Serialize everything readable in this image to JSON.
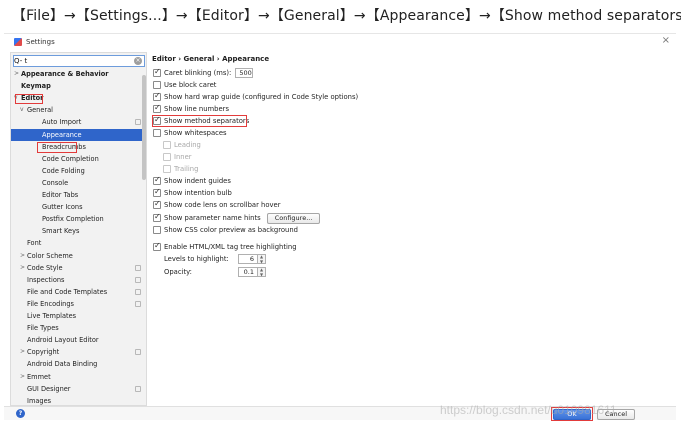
{
  "caption": "【File】→【Settings...】→【Editor】→【General】→【Appearance】→【Show method separators】",
  "window": {
    "title": "Settings",
    "close_glyph": "×"
  },
  "search": {
    "value": "Q- t",
    "icon": "search-icon"
  },
  "tree": [
    {
      "label": "Appearance & Behavior",
      "arrow": ">",
      "bold": true
    },
    {
      "label": "Keymap",
      "arrow": "",
      "bold": true
    },
    {
      "label": "Editor",
      "arrow": "v",
      "bold": true
    },
    {
      "label": "General",
      "arrow": "v",
      "bold": false
    },
    {
      "label": "Auto Import",
      "arrow": "",
      "bold": false,
      "cfg": true
    },
    {
      "label": "Appearance",
      "arrow": "",
      "bold": false,
      "selected": true
    },
    {
      "label": "Breadcrumbs",
      "arrow": "",
      "bold": false
    },
    {
      "label": "Code Completion",
      "arrow": "",
      "bold": false
    },
    {
      "label": "Code Folding",
      "arrow": "",
      "bold": false
    },
    {
      "label": "Console",
      "arrow": "",
      "bold": false
    },
    {
      "label": "Editor Tabs",
      "arrow": "",
      "bold": false
    },
    {
      "label": "Gutter Icons",
      "arrow": "",
      "bold": false
    },
    {
      "label": "Postfix Completion",
      "arrow": "",
      "bold": false
    },
    {
      "label": "Smart Keys",
      "arrow": "",
      "bold": false
    },
    {
      "label": "Font",
      "arrow": "",
      "bold": false
    },
    {
      "label": "Color Scheme",
      "arrow": ">",
      "bold": false
    },
    {
      "label": "Code Style",
      "arrow": ">",
      "bold": false,
      "cfg": true
    },
    {
      "label": "Inspections",
      "arrow": "",
      "bold": false,
      "cfg": true
    },
    {
      "label": "File and Code Templates",
      "arrow": "",
      "bold": false,
      "cfg": true
    },
    {
      "label": "File Encodings",
      "arrow": "",
      "bold": false,
      "cfg": true
    },
    {
      "label": "Live Templates",
      "arrow": "",
      "bold": false
    },
    {
      "label": "File Types",
      "arrow": "",
      "bold": false
    },
    {
      "label": "Android Layout Editor",
      "arrow": "",
      "bold": false
    },
    {
      "label": "Copyright",
      "arrow": ">",
      "bold": false,
      "cfg": true
    },
    {
      "label": "Android Data Binding",
      "arrow": "",
      "bold": false
    },
    {
      "label": "Emmet",
      "arrow": ">",
      "bold": false
    },
    {
      "label": "GUI Designer",
      "arrow": "",
      "bold": false,
      "cfg": true
    },
    {
      "label": "Images",
      "arrow": "",
      "bold": false
    }
  ],
  "breadcrumb": "Editor › General › Appearance",
  "options": {
    "caret_blinking": {
      "label": "Caret blinking (ms):",
      "checked": true,
      "value": "500"
    },
    "block_caret": {
      "label": "Use block caret",
      "checked": false
    },
    "hard_wrap": {
      "label": "Show hard wrap guide (configured in Code Style options)",
      "checked": true
    },
    "line_numbers": {
      "label": "Show line numbers",
      "checked": true
    },
    "method_separators": {
      "label": "Show method separators",
      "checked": true
    },
    "whitespaces": {
      "label": "Show whitespaces",
      "checked": false
    },
    "leading": {
      "label": "Leading",
      "checked": true
    },
    "inner": {
      "label": "Inner",
      "checked": true
    },
    "trailing": {
      "label": "Trailing",
      "checked": true
    },
    "indent_guides": {
      "label": "Show indent guides",
      "checked": true
    },
    "intention_bulb": {
      "label": "Show intention bulb",
      "checked": true
    },
    "code_lens": {
      "label": "Show code lens on scrollbar hover",
      "checked": true
    },
    "param_hints": {
      "label": "Show parameter name hints",
      "checked": true,
      "button": "Configure..."
    },
    "css_preview": {
      "label": "Show CSS color preview as background",
      "checked": false
    },
    "tag_highlight": {
      "label": "Enable HTML/XML tag tree highlighting",
      "checked": true
    },
    "levels": {
      "label": "Levels to highlight:",
      "value": "6"
    },
    "opacity": {
      "label": "Opacity:",
      "value": "0.1"
    }
  },
  "buttons": {
    "ok": "OK",
    "cancel": "Cancel",
    "help": "?"
  },
  "watermark": "https://blog.csdn.net/u010981611",
  "colors": {
    "selection": "#2f65ca",
    "highlight_box": "#e23b3b"
  }
}
